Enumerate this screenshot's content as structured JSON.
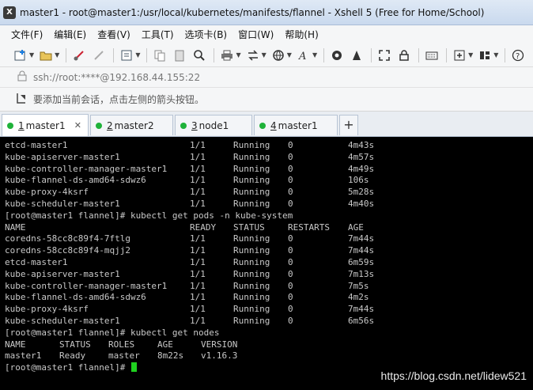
{
  "window": {
    "title": "master1 - root@master1:/usr/local/kubernetes/manifests/flannel - Xshell 5 (Free for Home/School)"
  },
  "menu": [
    "文件(F)",
    "编辑(E)",
    "查看(V)",
    "工具(T)",
    "选项卡(B)",
    "窗口(W)",
    "帮助(H)"
  ],
  "address": "ssh://root:****@192.168.44.155:22",
  "hint": "要添加当前会话，点击左侧的箭头按钮。",
  "tabs": [
    {
      "num": "1",
      "label": "master1"
    },
    {
      "num": "2",
      "label": "master2"
    },
    {
      "num": "3",
      "label": "node1"
    },
    {
      "num": "4",
      "label": "master1"
    }
  ],
  "terminal": {
    "pods_top": [
      [
        "etcd-master1",
        "1/1",
        "Running",
        "0",
        "4m43s"
      ],
      [
        "kube-apiserver-master1",
        "1/1",
        "Running",
        "0",
        "4m57s"
      ],
      [
        "kube-controller-manager-master1",
        "1/1",
        "Running",
        "0",
        "4m49s"
      ],
      [
        "kube-flannel-ds-amd64-sdwz6",
        "1/1",
        "Running",
        "0",
        "106s"
      ],
      [
        "kube-proxy-4ksrf",
        "1/1",
        "Running",
        "0",
        "5m28s"
      ],
      [
        "kube-scheduler-master1",
        "1/1",
        "Running",
        "0",
        "4m40s"
      ]
    ],
    "cmd1": "[root@master1 flannel]# kubectl get pods -n kube-system",
    "pods_header": [
      "NAME",
      "READY",
      "STATUS",
      "RESTARTS",
      "AGE"
    ],
    "pods": [
      [
        "coredns-58cc8c89f4-7ftlg",
        "1/1",
        "Running",
        "0",
        "7m44s"
      ],
      [
        "coredns-58cc8c89f4-mqjj2",
        "1/1",
        "Running",
        "0",
        "7m44s"
      ],
      [
        "etcd-master1",
        "1/1",
        "Running",
        "0",
        "6m59s"
      ],
      [
        "kube-apiserver-master1",
        "1/1",
        "Running",
        "0",
        "7m13s"
      ],
      [
        "kube-controller-manager-master1",
        "1/1",
        "Running",
        "0",
        "7m5s"
      ],
      [
        "kube-flannel-ds-amd64-sdwz6",
        "1/1",
        "Running",
        "0",
        "4m2s"
      ],
      [
        "kube-proxy-4ksrf",
        "1/1",
        "Running",
        "0",
        "7m44s"
      ],
      [
        "kube-scheduler-master1",
        "1/1",
        "Running",
        "0",
        "6m56s"
      ]
    ],
    "cmd2": "[root@master1 flannel]# kubectl get nodes",
    "nodes_header": [
      "NAME",
      "STATUS",
      "ROLES",
      "AGE",
      "VERSION"
    ],
    "nodes": [
      [
        "master1",
        "Ready",
        "master",
        "8m22s",
        "v1.16.3"
      ]
    ],
    "prompt": "[root@master1 flannel]#"
  },
  "watermark": "https://blog.csdn.net/lidew521",
  "colors": {
    "tab_status_dot": "#1fb23a",
    "cursor": "#1fd11f",
    "terminal_bg": "#000000"
  }
}
